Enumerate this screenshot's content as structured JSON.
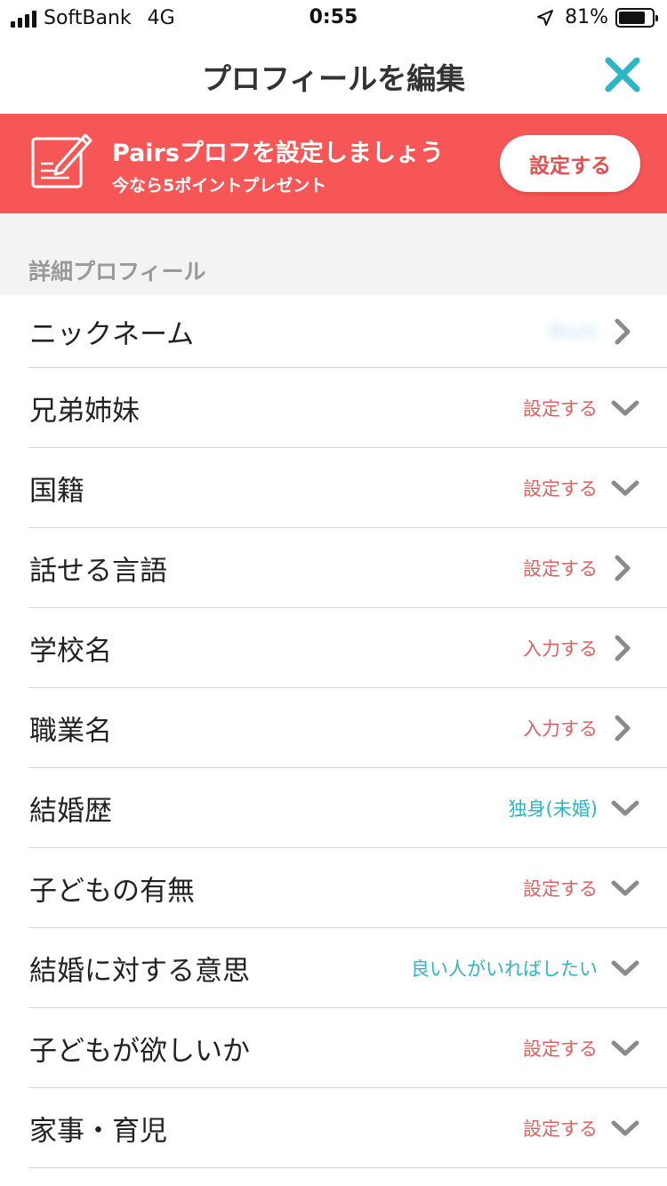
{
  "status_bar": {
    "carrier": "SoftBank",
    "network": "4G",
    "time": "0:55",
    "battery_percent": "81%",
    "battery_level": 0.81
  },
  "nav": {
    "title": "プロフィールを編集",
    "close_icon": "close-icon",
    "accent_color": "#2bb5c5"
  },
  "promo": {
    "title": "Pairsプロフを設定しましょう",
    "subtitle": "今なら5ポイントプレゼント",
    "button_label": "設定する",
    "background_color": "#f65656",
    "icon": "edit-note-icon"
  },
  "section": {
    "title": "詳細プロフィール"
  },
  "profile_rows": [
    {
      "label": "ニックネーム",
      "value": "Blurk",
      "value_style": "blurred",
      "icon": "chevron-right-icon"
    },
    {
      "label": "兄弟姉妹",
      "value": "設定する",
      "value_style": "unset",
      "icon": "chevron-down-icon"
    },
    {
      "label": "国籍",
      "value": "設定する",
      "value_style": "unset",
      "icon": "chevron-down-icon"
    },
    {
      "label": "話せる言語",
      "value": "設定する",
      "value_style": "unset",
      "icon": "chevron-right-icon"
    },
    {
      "label": "学校名",
      "value": "入力する",
      "value_style": "unset",
      "icon": "chevron-right-icon"
    },
    {
      "label": "職業名",
      "value": "入力する",
      "value_style": "unset",
      "icon": "chevron-right-icon"
    },
    {
      "label": "結婚歴",
      "value": "独身(未婚)",
      "value_style": "set",
      "icon": "chevron-down-icon"
    },
    {
      "label": "子どもの有無",
      "value": "設定する",
      "value_style": "unset",
      "icon": "chevron-down-icon"
    },
    {
      "label": "結婚に対する意思",
      "value": "良い人がいればしたい",
      "value_style": "set",
      "icon": "chevron-down-icon"
    },
    {
      "label": "子どもが欲しいか",
      "value": "設定する",
      "value_style": "unset",
      "icon": "chevron-down-icon"
    },
    {
      "label": "家事・育児",
      "value": "設定する",
      "value_style": "unset",
      "icon": "chevron-down-icon"
    }
  ],
  "colors": {
    "unset_value": "#e06060",
    "set_value": "#2bb5c5",
    "icon_gray": "#8a8a8a"
  }
}
